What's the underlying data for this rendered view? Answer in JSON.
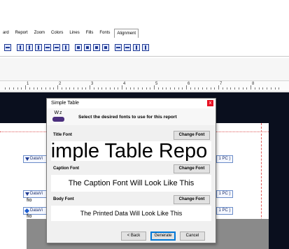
{
  "menu": {
    "items": [
      "ard",
      "Report",
      "Zoom",
      "Colors",
      "Lines",
      "Fills",
      "Fonts",
      "Alignment"
    ],
    "active_index": 7
  },
  "ruler": {
    "numbers": [
      "1",
      "2",
      "3",
      "4",
      "5",
      "6",
      "7",
      "8"
    ]
  },
  "report_bands": {
    "band_label": "DataVi",
    "field_text": "fio",
    "right_label": "1 PC )"
  },
  "dialog": {
    "title": "Simple Table",
    "close_label": "x",
    "icon_text": "Wz",
    "message": "Select the desired fonts to use for this report",
    "title_font": {
      "label": "Title Font",
      "button": "Change Font",
      "sample": "imple Table Repo"
    },
    "caption_font": {
      "label": "Caption Font",
      "button": "Change Font",
      "sample": "The Caption Font Will Look Like This"
    },
    "body_font": {
      "label": "Body Font",
      "button": "Change Font",
      "sample": "The Printed Data Will Look Like This"
    },
    "buttons": {
      "back": "< Back",
      "generate": "Generate",
      "cancel": "Cancel"
    }
  },
  "colors": {
    "dark_canvas": "#0a0f1e",
    "close_button": "#e81123",
    "margin_guide": "#e05a5a",
    "toolbar_icon": "#1f3a93"
  }
}
